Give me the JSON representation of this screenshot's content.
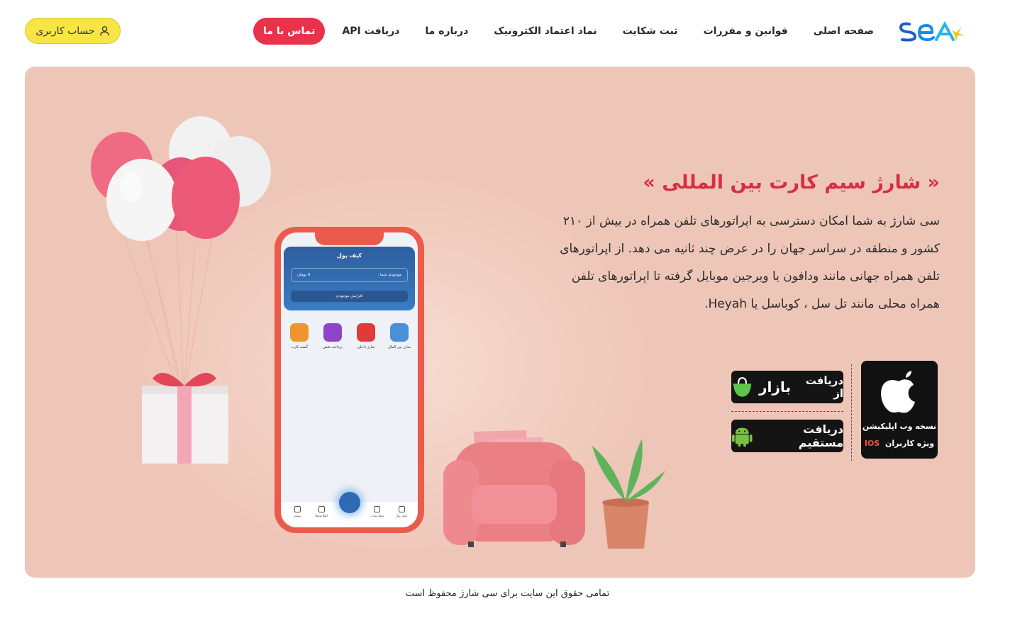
{
  "header": {
    "logo_text": "SEA",
    "nav": [
      {
        "label": "صفحه اصلی"
      },
      {
        "label": "قوانین و مقررات"
      },
      {
        "label": "ثبت شکایت"
      },
      {
        "label": "نماد اعتماد الکترونیک"
      },
      {
        "label": "درباره ما"
      },
      {
        "label": "دریافت API"
      }
    ],
    "contact_label": "تماس با ما",
    "account_label": "حساب کاربری"
  },
  "hero": {
    "title": "« شارژ سیم کارت بین المللی »",
    "description": "سی شارژ به شما امکان دسترسی به اپراتورهای تلفن همراه در بیش از ۲۱۰ کشور و منطقه در سراسر جهان را در عرض چند ثانیه می دهد. از اپراتورهای تلفن همراه جهانی مانند ودافون یا ویرجین موبایل گرفته تا اپراتورهای تلفن همراه محلی مانند تل سل ، کوباسل یا Heyah."
  },
  "downloads": {
    "ios_line1": "نسخه وب اپلیکیشن",
    "ios_line2_prefix": "ویژه کاربران",
    "ios_line2_highlight": "IOS",
    "bazaar_prefix": "دریافت از",
    "bazaar_brand": "بازار",
    "direct_label": "دریافت مستقیم"
  },
  "phone": {
    "wallet_title": "کیف پول",
    "balance_label": "موجودی شما :",
    "balance_value": "0 تومان",
    "increase_label": "افزایش موجودی",
    "services": [
      {
        "label": "شارژ بین الملل",
        "color": "#4a90d9"
      },
      {
        "label": "شارژ داخلی",
        "color": "#e03a3a"
      },
      {
        "label": "پرداخت قبض",
        "color": "#8e44c9"
      },
      {
        "label": "گیفت کارت",
        "color": "#f0952e"
      }
    ],
    "tabs": [
      {
        "label": "کیف پول"
      },
      {
        "label": "سفارشات"
      },
      {
        "label": "اطلاعیه‌ها"
      },
      {
        "label": "بیشتر"
      }
    ]
  },
  "footer": {
    "copyright": "تمامی حقوق این سایت برای سی شارژ محفوظ است"
  },
  "colors": {
    "accent": "#e8334a",
    "hero_bg": "#eec6b8",
    "account_bg": "#f7e545",
    "title_red": "#d62f43"
  }
}
